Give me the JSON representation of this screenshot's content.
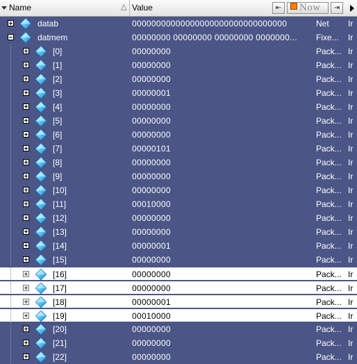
{
  "header": {
    "name_label": "Name",
    "value_label": "Value",
    "sort_symbol": "△",
    "now_label": "Now",
    "btn_left_symbol": "⇤",
    "btn_right_symbol": "⇥"
  },
  "signals": [
    {
      "name": "datab",
      "value": "00000000000000000000000000000000",
      "type": "Net",
      "extra": "Ir",
      "level": 0,
      "expanded": false,
      "highlighted": false
    },
    {
      "name": "datmem",
      "value": "00000000 00000000 00000000 0000000...",
      "type": "Fixe...",
      "extra": "Ir",
      "level": 0,
      "expanded": true,
      "highlighted": false
    },
    {
      "name": "[0]",
      "value": "00000000",
      "type": "Pack...",
      "extra": "Ir",
      "level": 1,
      "expanded": false,
      "highlighted": false
    },
    {
      "name": "[1]",
      "value": "00000000",
      "type": "Pack...",
      "extra": "Ir",
      "level": 1,
      "expanded": false,
      "highlighted": false
    },
    {
      "name": "[2]",
      "value": "00000000",
      "type": "Pack...",
      "extra": "Ir",
      "level": 1,
      "expanded": false,
      "highlighted": false
    },
    {
      "name": "[3]",
      "value": "00000001",
      "type": "Pack...",
      "extra": "Ir",
      "level": 1,
      "expanded": false,
      "highlighted": false
    },
    {
      "name": "[4]",
      "value": "00000000",
      "type": "Pack...",
      "extra": "Ir",
      "level": 1,
      "expanded": false,
      "highlighted": false
    },
    {
      "name": "[5]",
      "value": "00000000",
      "type": "Pack...",
      "extra": "Ir",
      "level": 1,
      "expanded": false,
      "highlighted": false
    },
    {
      "name": "[6]",
      "value": "00000000",
      "type": "Pack...",
      "extra": "Ir",
      "level": 1,
      "expanded": false,
      "highlighted": false
    },
    {
      "name": "[7]",
      "value": "00000101",
      "type": "Pack...",
      "extra": "Ir",
      "level": 1,
      "expanded": false,
      "highlighted": false
    },
    {
      "name": "[8]",
      "value": "00000000",
      "type": "Pack...",
      "extra": "Ir",
      "level": 1,
      "expanded": false,
      "highlighted": false
    },
    {
      "name": "[9]",
      "value": "00000000",
      "type": "Pack...",
      "extra": "Ir",
      "level": 1,
      "expanded": false,
      "highlighted": false
    },
    {
      "name": "[10]",
      "value": "00000000",
      "type": "Pack...",
      "extra": "Ir",
      "level": 1,
      "expanded": false,
      "highlighted": false
    },
    {
      "name": "[11]",
      "value": "00010000",
      "type": "Pack...",
      "extra": "Ir",
      "level": 1,
      "expanded": false,
      "highlighted": false
    },
    {
      "name": "[12]",
      "value": "00000000",
      "type": "Pack...",
      "extra": "Ir",
      "level": 1,
      "expanded": false,
      "highlighted": false
    },
    {
      "name": "[13]",
      "value": "00000000",
      "type": "Pack...",
      "extra": "Ir",
      "level": 1,
      "expanded": false,
      "highlighted": false
    },
    {
      "name": "[14]",
      "value": "00000001",
      "type": "Pack...",
      "extra": "Ir",
      "level": 1,
      "expanded": false,
      "highlighted": false
    },
    {
      "name": "[15]",
      "value": "00000000",
      "type": "Pack...",
      "extra": "Ir",
      "level": 1,
      "expanded": false,
      "highlighted": false
    },
    {
      "name": "[16]",
      "value": "00000000",
      "type": "Pack...",
      "extra": "Ir",
      "level": 1,
      "expanded": false,
      "highlighted": true
    },
    {
      "name": "[17]",
      "value": "00000000",
      "type": "Pack...",
      "extra": "Ir",
      "level": 1,
      "expanded": false,
      "highlighted": true
    },
    {
      "name": "[18]",
      "value": "00000001",
      "type": "Pack...",
      "extra": "Ir",
      "level": 1,
      "expanded": false,
      "highlighted": true
    },
    {
      "name": "[19]",
      "value": "00010000",
      "type": "Pack...",
      "extra": "Ir",
      "level": 1,
      "expanded": false,
      "highlighted": true
    },
    {
      "name": "[20]",
      "value": "00000000",
      "type": "Pack...",
      "extra": "Ir",
      "level": 1,
      "expanded": false,
      "highlighted": false
    },
    {
      "name": "[21]",
      "value": "00000000",
      "type": "Pack...",
      "extra": "Ir",
      "level": 1,
      "expanded": false,
      "highlighted": false
    },
    {
      "name": "[22]",
      "value": "00000000",
      "type": "Pack...",
      "extra": "Ir",
      "level": 1,
      "expanded": false,
      "highlighted": false
    }
  ],
  "colors": {
    "background": "#4b5586",
    "highlight_row": "#ffffff",
    "diamond_light": "#8fe3ff",
    "diamond_dark": "#1a8fd6",
    "now_square": "#ff8000"
  },
  "icons": {
    "signal": "diamond-signal-icon",
    "expand": "plus-box-icon",
    "collapse": "minus-box-icon"
  }
}
